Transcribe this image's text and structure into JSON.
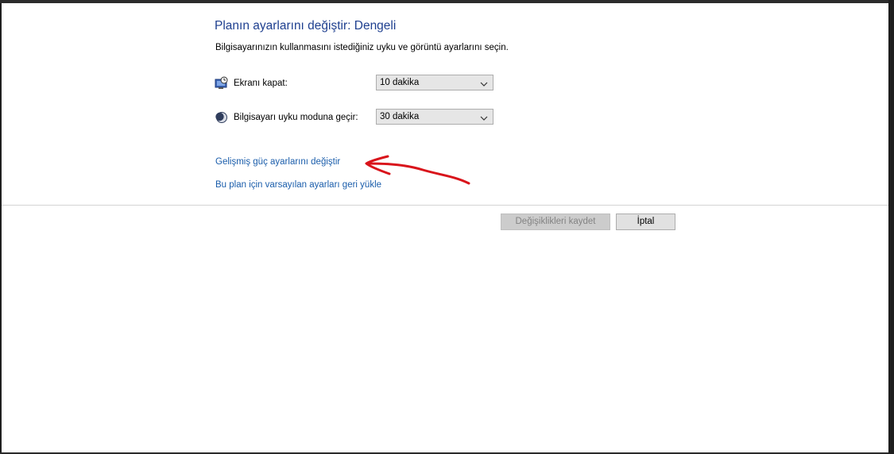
{
  "page": {
    "title": "Planın ayarlarını değiştir: Dengeli",
    "subtitle": "Bilgisayarınızın kullanmasını istediğiniz uyku ve görüntü ayarlarını seçin."
  },
  "settings": [
    {
      "icon": "monitor-clock-icon",
      "label": "Ekranı kapat:",
      "value": "10 dakika"
    },
    {
      "icon": "moon-icon",
      "label": "Bilgisayarı uyku moduna geçir:",
      "value": "30 dakika"
    }
  ],
  "links": {
    "advanced": "Gelişmiş güç ayarlarını değiştir",
    "restore_defaults": "Bu plan için varsayılan ayarları geri yükle"
  },
  "buttons": {
    "save": "Değişiklikleri kaydet",
    "cancel": "İptal"
  },
  "colors": {
    "title": "#1e3f8f",
    "link": "#1a5dab",
    "annotation": "#d9141b"
  }
}
